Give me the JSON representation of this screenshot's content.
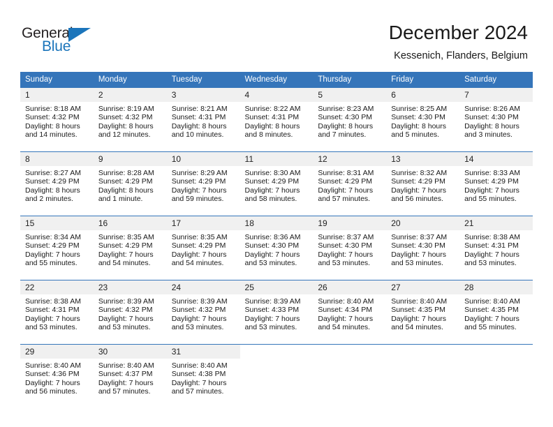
{
  "brand": {
    "name_top": "General",
    "name_bottom": "Blue",
    "color_dark": "#231f20",
    "color_blue": "#1b75bb"
  },
  "header": {
    "title": "December 2024",
    "subtitle": "Kessenich, Flanders, Belgium",
    "header_bg": "#3575ba",
    "daynum_bg": "#f0f0f0"
  },
  "weekday_headers": [
    "Sunday",
    "Monday",
    "Tuesday",
    "Wednesday",
    "Thursday",
    "Friday",
    "Saturday"
  ],
  "weeks": [
    [
      {
        "day": "1",
        "sunrise": "Sunrise: 8:18 AM",
        "sunset": "Sunset: 4:32 PM",
        "daylight1": "Daylight: 8 hours",
        "daylight2": "and 14 minutes."
      },
      {
        "day": "2",
        "sunrise": "Sunrise: 8:19 AM",
        "sunset": "Sunset: 4:32 PM",
        "daylight1": "Daylight: 8 hours",
        "daylight2": "and 12 minutes."
      },
      {
        "day": "3",
        "sunrise": "Sunrise: 8:21 AM",
        "sunset": "Sunset: 4:31 PM",
        "daylight1": "Daylight: 8 hours",
        "daylight2": "and 10 minutes."
      },
      {
        "day": "4",
        "sunrise": "Sunrise: 8:22 AM",
        "sunset": "Sunset: 4:31 PM",
        "daylight1": "Daylight: 8 hours",
        "daylight2": "and 8 minutes."
      },
      {
        "day": "5",
        "sunrise": "Sunrise: 8:23 AM",
        "sunset": "Sunset: 4:30 PM",
        "daylight1": "Daylight: 8 hours",
        "daylight2": "and 7 minutes."
      },
      {
        "day": "6",
        "sunrise": "Sunrise: 8:25 AM",
        "sunset": "Sunset: 4:30 PM",
        "daylight1": "Daylight: 8 hours",
        "daylight2": "and 5 minutes."
      },
      {
        "day": "7",
        "sunrise": "Sunrise: 8:26 AM",
        "sunset": "Sunset: 4:30 PM",
        "daylight1": "Daylight: 8 hours",
        "daylight2": "and 3 minutes."
      }
    ],
    [
      {
        "day": "8",
        "sunrise": "Sunrise: 8:27 AM",
        "sunset": "Sunset: 4:29 PM",
        "daylight1": "Daylight: 8 hours",
        "daylight2": "and 2 minutes."
      },
      {
        "day": "9",
        "sunrise": "Sunrise: 8:28 AM",
        "sunset": "Sunset: 4:29 PM",
        "daylight1": "Daylight: 8 hours",
        "daylight2": "and 1 minute."
      },
      {
        "day": "10",
        "sunrise": "Sunrise: 8:29 AM",
        "sunset": "Sunset: 4:29 PM",
        "daylight1": "Daylight: 7 hours",
        "daylight2": "and 59 minutes."
      },
      {
        "day": "11",
        "sunrise": "Sunrise: 8:30 AM",
        "sunset": "Sunset: 4:29 PM",
        "daylight1": "Daylight: 7 hours",
        "daylight2": "and 58 minutes."
      },
      {
        "day": "12",
        "sunrise": "Sunrise: 8:31 AM",
        "sunset": "Sunset: 4:29 PM",
        "daylight1": "Daylight: 7 hours",
        "daylight2": "and 57 minutes."
      },
      {
        "day": "13",
        "sunrise": "Sunrise: 8:32 AM",
        "sunset": "Sunset: 4:29 PM",
        "daylight1": "Daylight: 7 hours",
        "daylight2": "and 56 minutes."
      },
      {
        "day": "14",
        "sunrise": "Sunrise: 8:33 AM",
        "sunset": "Sunset: 4:29 PM",
        "daylight1": "Daylight: 7 hours",
        "daylight2": "and 55 minutes."
      }
    ],
    [
      {
        "day": "15",
        "sunrise": "Sunrise: 8:34 AM",
        "sunset": "Sunset: 4:29 PM",
        "daylight1": "Daylight: 7 hours",
        "daylight2": "and 55 minutes."
      },
      {
        "day": "16",
        "sunrise": "Sunrise: 8:35 AM",
        "sunset": "Sunset: 4:29 PM",
        "daylight1": "Daylight: 7 hours",
        "daylight2": "and 54 minutes."
      },
      {
        "day": "17",
        "sunrise": "Sunrise: 8:35 AM",
        "sunset": "Sunset: 4:29 PM",
        "daylight1": "Daylight: 7 hours",
        "daylight2": "and 54 minutes."
      },
      {
        "day": "18",
        "sunrise": "Sunrise: 8:36 AM",
        "sunset": "Sunset: 4:30 PM",
        "daylight1": "Daylight: 7 hours",
        "daylight2": "and 53 minutes."
      },
      {
        "day": "19",
        "sunrise": "Sunrise: 8:37 AM",
        "sunset": "Sunset: 4:30 PM",
        "daylight1": "Daylight: 7 hours",
        "daylight2": "and 53 minutes."
      },
      {
        "day": "20",
        "sunrise": "Sunrise: 8:37 AM",
        "sunset": "Sunset: 4:30 PM",
        "daylight1": "Daylight: 7 hours",
        "daylight2": "and 53 minutes."
      },
      {
        "day": "21",
        "sunrise": "Sunrise: 8:38 AM",
        "sunset": "Sunset: 4:31 PM",
        "daylight1": "Daylight: 7 hours",
        "daylight2": "and 53 minutes."
      }
    ],
    [
      {
        "day": "22",
        "sunrise": "Sunrise: 8:38 AM",
        "sunset": "Sunset: 4:31 PM",
        "daylight1": "Daylight: 7 hours",
        "daylight2": "and 53 minutes."
      },
      {
        "day": "23",
        "sunrise": "Sunrise: 8:39 AM",
        "sunset": "Sunset: 4:32 PM",
        "daylight1": "Daylight: 7 hours",
        "daylight2": "and 53 minutes."
      },
      {
        "day": "24",
        "sunrise": "Sunrise: 8:39 AM",
        "sunset": "Sunset: 4:32 PM",
        "daylight1": "Daylight: 7 hours",
        "daylight2": "and 53 minutes."
      },
      {
        "day": "25",
        "sunrise": "Sunrise: 8:39 AM",
        "sunset": "Sunset: 4:33 PM",
        "daylight1": "Daylight: 7 hours",
        "daylight2": "and 53 minutes."
      },
      {
        "day": "26",
        "sunrise": "Sunrise: 8:40 AM",
        "sunset": "Sunset: 4:34 PM",
        "daylight1": "Daylight: 7 hours",
        "daylight2": "and 54 minutes."
      },
      {
        "day": "27",
        "sunrise": "Sunrise: 8:40 AM",
        "sunset": "Sunset: 4:35 PM",
        "daylight1": "Daylight: 7 hours",
        "daylight2": "and 54 minutes."
      },
      {
        "day": "28",
        "sunrise": "Sunrise: 8:40 AM",
        "sunset": "Sunset: 4:35 PM",
        "daylight1": "Daylight: 7 hours",
        "daylight2": "and 55 minutes."
      }
    ],
    [
      {
        "day": "29",
        "sunrise": "Sunrise: 8:40 AM",
        "sunset": "Sunset: 4:36 PM",
        "daylight1": "Daylight: 7 hours",
        "daylight2": "and 56 minutes."
      },
      {
        "day": "30",
        "sunrise": "Sunrise: 8:40 AM",
        "sunset": "Sunset: 4:37 PM",
        "daylight1": "Daylight: 7 hours",
        "daylight2": "and 57 minutes."
      },
      {
        "day": "31",
        "sunrise": "Sunrise: 8:40 AM",
        "sunset": "Sunset: 4:38 PM",
        "daylight1": "Daylight: 7 hours",
        "daylight2": "and 57 minutes."
      },
      {
        "day": "",
        "sunrise": "",
        "sunset": "",
        "daylight1": "",
        "daylight2": ""
      },
      {
        "day": "",
        "sunrise": "",
        "sunset": "",
        "daylight1": "",
        "daylight2": ""
      },
      {
        "day": "",
        "sunrise": "",
        "sunset": "",
        "daylight1": "",
        "daylight2": ""
      },
      {
        "day": "",
        "sunrise": "",
        "sunset": "",
        "daylight1": "",
        "daylight2": ""
      }
    ]
  ]
}
